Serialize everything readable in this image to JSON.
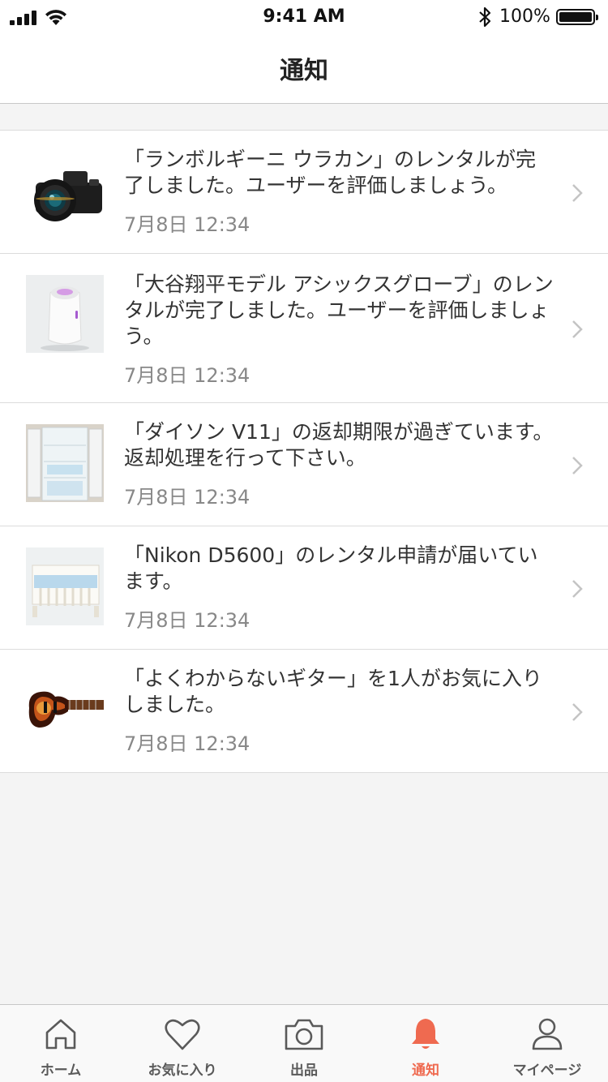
{
  "status_bar": {
    "time": "9:41 AM",
    "battery": "100%"
  },
  "header": {
    "title": "通知"
  },
  "notifications": [
    {
      "message": "「ランボルギーニ ウラカン」のレンタルが完了しました。ユーザーを評価しましょう。",
      "date": "7月8日 12:34",
      "thumb": "camera-image"
    },
    {
      "message": "「大谷翔平モデル アシックスグローブ」のレンタルが完了しました。ユーザーを評価しましょう。",
      "date": "7月8日 12:34",
      "thumb": "humidifier-image"
    },
    {
      "message": "「ダイソン V11」の返却期限が過ぎています。返却処理を行って下さい。",
      "date": "7月8日 12:34",
      "thumb": "refrigerator-image"
    },
    {
      "message": "「Nikon D5600」のレンタル申請が届いています。",
      "date": "7月8日 12:34",
      "thumb": "baby-crib-image"
    },
    {
      "message": "「よくわからないギター」を1人がお気に入りしました。",
      "date": "7月8日 12:34",
      "thumb": "bass-guitar-image"
    }
  ],
  "tabbar": {
    "tabs": [
      {
        "label": "ホーム",
        "icon": "home-icon"
      },
      {
        "label": "お気に入り",
        "icon": "heart-icon"
      },
      {
        "label": "出品",
        "icon": "camera-icon"
      },
      {
        "label": "通知",
        "icon": "bell-icon",
        "active": true
      },
      {
        "label": "マイページ",
        "icon": "person-icon"
      }
    ],
    "active_color": "#ef6a50",
    "inactive_color": "#5a5a5a"
  }
}
